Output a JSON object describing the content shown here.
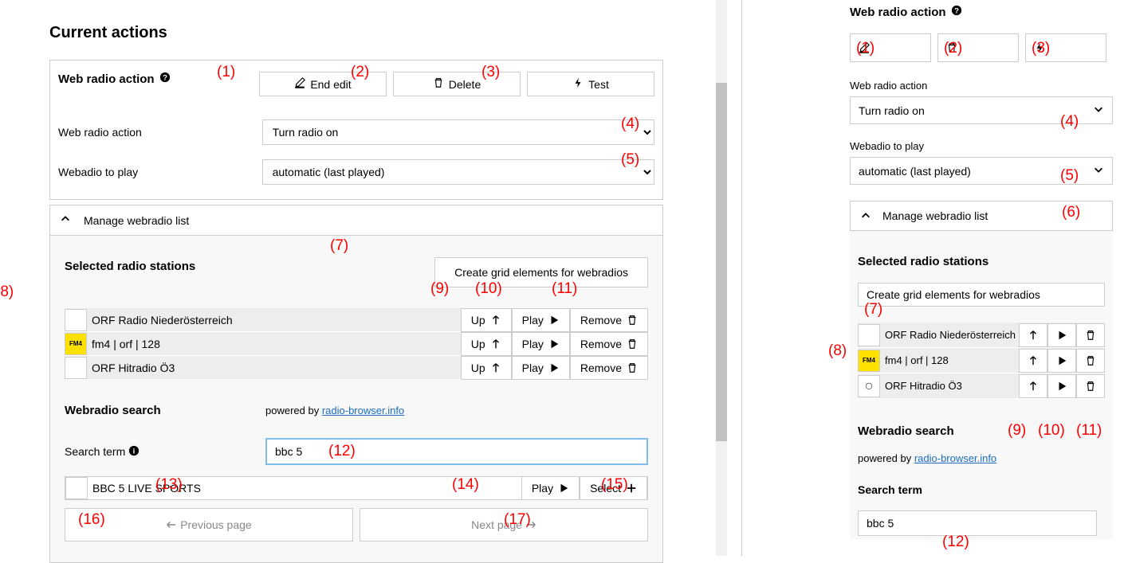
{
  "page": {
    "title": "Current actions"
  },
  "header": {
    "section_title": "Web radio action",
    "buttons": {
      "end_edit": "End edit",
      "delete": "Delete",
      "test": "Test"
    }
  },
  "form": {
    "action_label": "Web radio action",
    "action_value": "Turn radio on",
    "play_label": "Webadio to play",
    "play_value": "automatic (last played)"
  },
  "accordion": {
    "title": "Manage webradio list"
  },
  "selected": {
    "title": "Selected radio stations",
    "create_grid": "Create grid elements for webradios",
    "stations": [
      {
        "name": "ORF Radio Niederösterreich",
        "icon": "blank"
      },
      {
        "name": "fm4 | orf | 128",
        "icon": "fm4"
      },
      {
        "name": "ORF Hitradio Ö3",
        "icon": "o3"
      }
    ],
    "row_actions": {
      "up": "Up",
      "play": "Play",
      "remove": "Remove"
    }
  },
  "search": {
    "title": "Webradio search",
    "powered": "powered by ",
    "link": "radio-browser.info",
    "term_label": "Search term",
    "term_value": "bbc 5",
    "results": [
      {
        "name": "BBC 5 LIVE SPORTS"
      }
    ],
    "row_actions": {
      "play": "Play",
      "select": "Select"
    },
    "prev": "Previous page",
    "next": "Next page"
  },
  "annotations": {
    "a1": "(1)",
    "a2": "(2)",
    "a3": "(3)",
    "a4": "(4)",
    "a5": "(5)",
    "a6": "(6)",
    "a7": "(7)",
    "a8": "(8)",
    "a9": "(9)",
    "a10": "(10)",
    "a11": "(11)",
    "a12": "(12)",
    "a13": "(13)",
    "a14": "(14)",
    "a15": "(15)",
    "a16": "(16)",
    "a17": "(17)"
  }
}
